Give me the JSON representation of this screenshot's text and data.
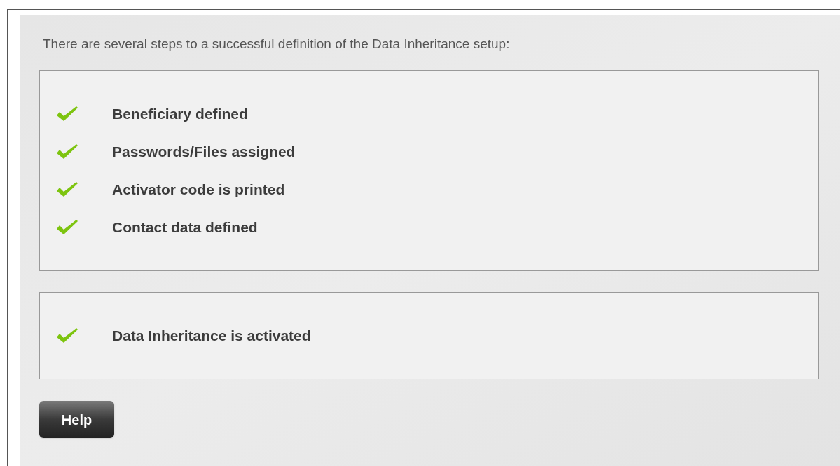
{
  "intro": "There are several steps to a successful definition of the Data Inheritance setup:",
  "groups": [
    {
      "steps": [
        {
          "label": "Beneficiary defined",
          "done": true
        },
        {
          "label": "Passwords/Files assigned",
          "done": true
        },
        {
          "label": "Activator code is printed",
          "done": true
        },
        {
          "label": "Contact data defined",
          "done": true
        }
      ]
    },
    {
      "steps": [
        {
          "label": "Data Inheritance is activated",
          "done": true
        }
      ]
    }
  ],
  "button": "Help"
}
